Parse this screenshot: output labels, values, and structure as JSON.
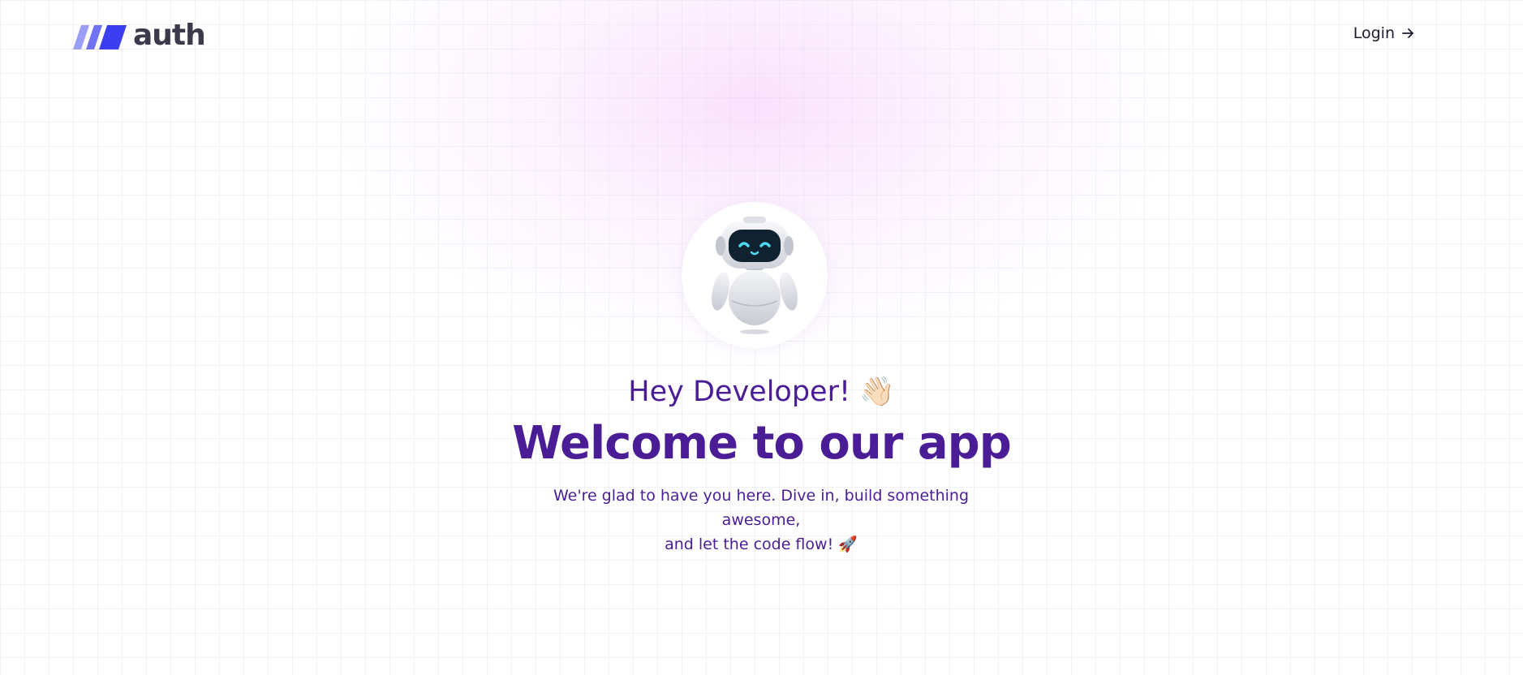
{
  "header": {
    "logo_text": "auth",
    "login_label": "Login",
    "login_icon": "arrow-right-icon"
  },
  "hero": {
    "avatar_icon": "robot-icon",
    "greeting": "Hey Developer! 👋🏻",
    "headline": "Welcome to our app",
    "subtext_line1": "We're glad to have you here. Dive in, build something awesome,",
    "subtext_line2": "and let the code flow! 🚀"
  },
  "colors": {
    "accent": "#4a1d96",
    "logo_mark_light": "#8b8ff5",
    "logo_mark_dark": "#3b3ff0",
    "logo_text": "#3a3a4a"
  }
}
